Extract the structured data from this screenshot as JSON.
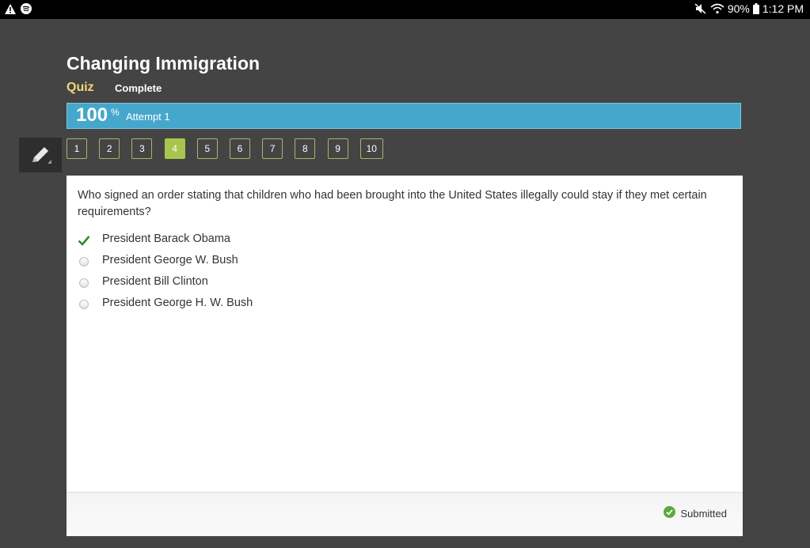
{
  "status_bar": {
    "left_icons": [
      "warning-icon",
      "spotify-icon"
    ],
    "right_icons": [
      "mute-icon",
      "wifi-icon",
      "battery-icon"
    ],
    "battery": "90%",
    "time": "1:12 PM"
  },
  "header": {
    "title": "Changing Immigration",
    "type_label": "Quiz",
    "status_label": "Complete"
  },
  "score": {
    "value": "100",
    "unit": "%",
    "attempt": "Attempt 1"
  },
  "tools": {
    "pencil_icon": "pencil-icon"
  },
  "question_nav": {
    "items": [
      "1",
      "2",
      "3",
      "4",
      "5",
      "6",
      "7",
      "8",
      "9",
      "10"
    ],
    "active_index": 3
  },
  "question": {
    "text": "Who signed an order stating that children who had been brought into the United States illegally could stay if they met certain requirements?",
    "options": [
      {
        "label": "President Barack Obama",
        "selected": true
      },
      {
        "label": "President George W. Bush",
        "selected": false
      },
      {
        "label": "President Bill Clinton",
        "selected": false
      },
      {
        "label": "President George H. W. Bush",
        "selected": false
      }
    ]
  },
  "footer": {
    "status": "Submitted"
  },
  "colors": {
    "background": "#444444",
    "accent_blue": "#46a7cc",
    "active_green": "#a8c64e",
    "quiz_yellow": "#f0d878",
    "check_green": "#2e8b2e"
  }
}
